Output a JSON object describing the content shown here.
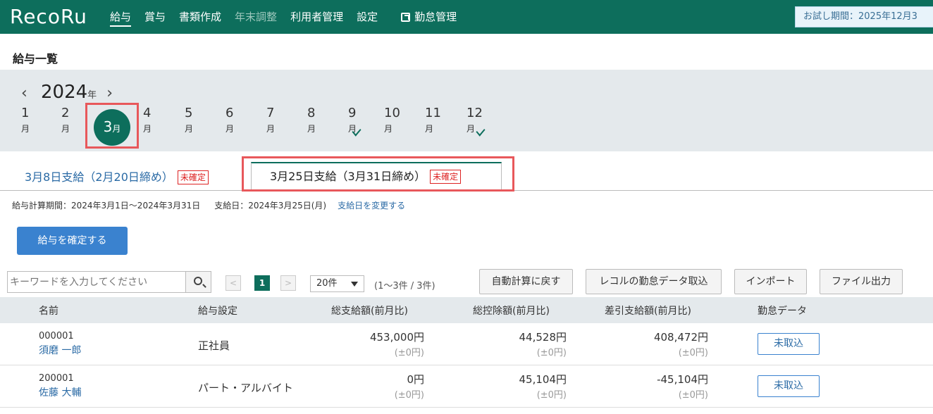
{
  "header": {
    "logo": "RecoRu",
    "nav": [
      {
        "label": "給与",
        "active": true
      },
      {
        "label": "賞与"
      },
      {
        "label": "書類作成"
      },
      {
        "label": "年末調整",
        "disabled": true
      },
      {
        "label": "利用者管理"
      },
      {
        "label": "設定"
      }
    ],
    "external_link": "勤怠管理",
    "trial": "お試し期間：2025年12月3"
  },
  "page_title": "給与一覧",
  "year": {
    "value": "2024",
    "unit": "年"
  },
  "months": [
    {
      "num": "1",
      "u": "月"
    },
    {
      "num": "2",
      "u": "月"
    },
    {
      "num": "3",
      "u": "月",
      "selected": true
    },
    {
      "num": "4",
      "u": "月"
    },
    {
      "num": "5",
      "u": "月"
    },
    {
      "num": "6",
      "u": "月"
    },
    {
      "num": "7",
      "u": "月"
    },
    {
      "num": "8",
      "u": "月"
    },
    {
      "num": "9",
      "u": "月",
      "checked": true
    },
    {
      "num": "10",
      "u": "月"
    },
    {
      "num": "11",
      "u": "月"
    },
    {
      "num": "12",
      "u": "月",
      "checked": true
    }
  ],
  "tabs": [
    {
      "label": "3月8日支給（2月20日締め）",
      "badge": "未確定"
    },
    {
      "label": "3月25日支給（3月31日締め）",
      "badge": "未確定",
      "active": true
    }
  ],
  "period": {
    "calc": "給与計算期間：2024年3月1日～2024年3月31日",
    "payday": "支給日：2024年3月25日(月)",
    "change_link": "支給日を変更する"
  },
  "confirm_button": "給与を確定する",
  "toolbar": {
    "search_placeholder": "キーワードを入力してください",
    "prev": "<",
    "page": "1",
    "next": ">",
    "per_page": "20件",
    "range": "(1～3件 / 3件)",
    "buttons": [
      "自動計算に戻す",
      "レコルの勤怠データ取込",
      "インポート",
      "ファイル出力"
    ]
  },
  "table": {
    "headers": [
      "名前",
      "給与設定",
      "総支給額(前月比)",
      "総控除額(前月比)",
      "差引支給額(前月比)",
      "勤怠データ"
    ],
    "rows": [
      {
        "code": "000001",
        "name": "須磨 一郎",
        "setting": "正社員",
        "gross": "453,000円",
        "gross_diff": "(±0円)",
        "deduction": "44,528円",
        "deduction_diff": "(±0円)",
        "net": "408,472円",
        "net_diff": "(±0円)",
        "attendance": "未取込"
      },
      {
        "code": "200001",
        "name": "佐藤 大輔",
        "setting": "パート・アルバイト",
        "gross": "0円",
        "gross_diff": "(±0円)",
        "deduction": "45,104円",
        "deduction_diff": "(±0円)",
        "net": "-45,104円",
        "net_diff": "(±0円)",
        "attendance": "未取込"
      }
    ]
  }
}
